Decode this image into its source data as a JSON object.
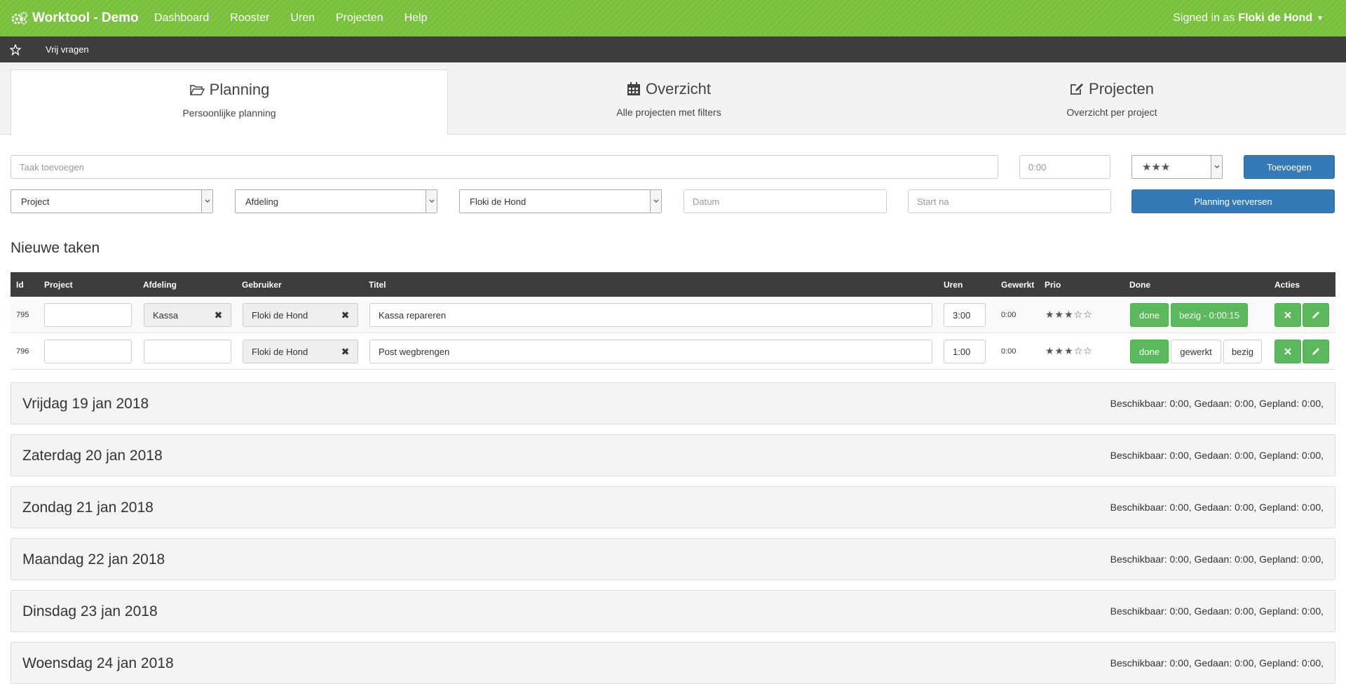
{
  "nav": {
    "brand": "Worktool - Demo",
    "links": [
      "Dashboard",
      "Rooster",
      "Uren",
      "Projecten",
      "Help"
    ],
    "signed_in_prefix": "Signed in as",
    "user": "Floki de Hond"
  },
  "subnav": {
    "link": "Vrij vragen"
  },
  "tabs": [
    {
      "title": "Planning",
      "subtitle": "Persoonlijke planning",
      "icon": "folder-open-icon"
    },
    {
      "title": "Overzicht",
      "subtitle": "Alle projecten met filters",
      "icon": "calendar-icon"
    },
    {
      "title": "Projecten",
      "subtitle": "Overzicht per project",
      "icon": "edit-icon"
    }
  ],
  "form": {
    "task_placeholder": "Taak toevoegen",
    "hours_placeholder": "0:00",
    "prio_value": "★★★",
    "add_label": "Toevoegen",
    "project_select": "Project",
    "department_select": "Afdeling",
    "user_select": "Floki de Hond",
    "date_placeholder": "Datum",
    "start_placeholder": "Start na",
    "refresh_label": "Planning verversen"
  },
  "section_title": "Nieuwe taken",
  "table": {
    "headers": [
      "Id",
      "Project",
      "Afdeling",
      "Gebruiker",
      "Titel",
      "Uren",
      "Gewerkt",
      "Prio",
      "Done",
      "Acties"
    ],
    "rows": [
      {
        "id": "795",
        "project": "",
        "department": "Kassa",
        "user": "Floki de Hond",
        "title": "Kassa repareren",
        "hours": "3:00",
        "worked": "0:00",
        "prio": "★★★☆☆",
        "done_label": "done",
        "busy_label": "bezig - 0:00:15"
      },
      {
        "id": "796",
        "project": "",
        "department": "",
        "user": "Floki de Hond",
        "title": "Post wegbrengen",
        "hours": "1:00",
        "worked": "0:00",
        "prio": "★★★☆☆",
        "done_label": "done",
        "worked_label": "gewerkt",
        "busy_label": "bezig"
      }
    ]
  },
  "days": [
    {
      "title": "Vrijdag 19 jan 2018",
      "summary": "Beschikbaar: 0:00, Gedaan: 0:00, Gepland: 0:00,"
    },
    {
      "title": "Zaterdag 20 jan 2018",
      "summary": "Beschikbaar: 0:00, Gedaan: 0:00, Gepland: 0:00,"
    },
    {
      "title": "Zondag 21 jan 2018",
      "summary": "Beschikbaar: 0:00, Gedaan: 0:00, Gepland: 0:00,"
    },
    {
      "title": "Maandag 22 jan 2018",
      "summary": "Beschikbaar: 0:00, Gedaan: 0:00, Gepland: 0:00,"
    },
    {
      "title": "Dinsdag 23 jan 2018",
      "summary": "Beschikbaar: 0:00, Gedaan: 0:00, Gepland: 0:00,"
    },
    {
      "title": "Woensdag 24 jan 2018",
      "summary": "Beschikbaar: 0:00, Gedaan: 0:00, Gepland: 0:00,"
    }
  ],
  "colors": {
    "nav_green": "#7fc544",
    "dark_bar": "#3d3d3d",
    "primary_blue": "#337ab7",
    "success_green": "#5cb85c"
  }
}
